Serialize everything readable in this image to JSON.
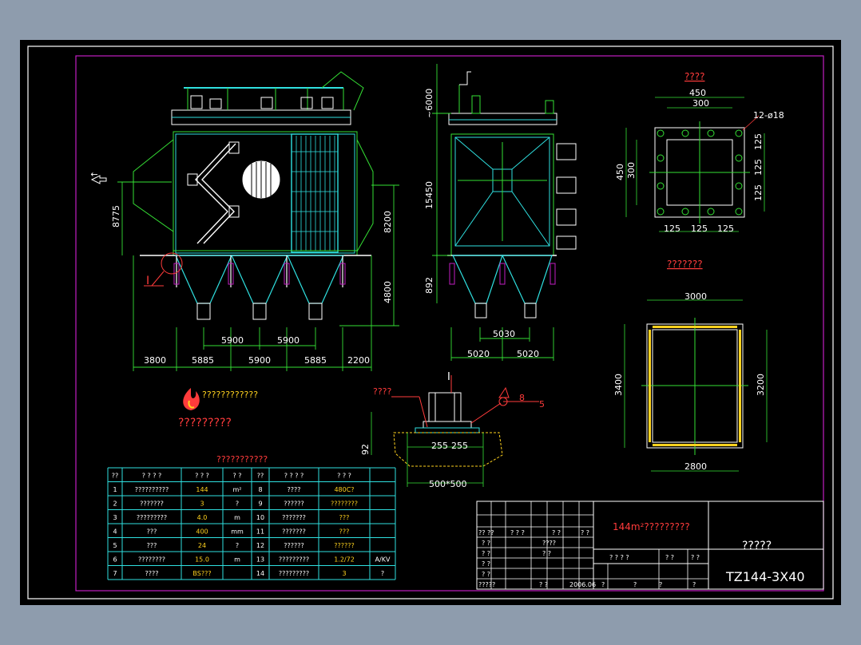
{
  "colors": {
    "background": "#8e9cad",
    "sheet": "#000000",
    "frame": "#ffffff",
    "border": "#c21ec2",
    "green": "#35e035",
    "cyan": "#2fe0e0",
    "white": "#ffffff",
    "red": "#ff3b3b",
    "yellow": "#ffd21e"
  },
  "elevation_view": {
    "flow_arrow_label": "↑",
    "dims_vertical": [
      "8775",
      "8200",
      "4800"
    ],
    "dims_top": [
      "5900",
      "5900"
    ],
    "dims_bottom": [
      "3800",
      "5885",
      "5900",
      "5885",
      "2200"
    ],
    "detail_marker": "I"
  },
  "side_view": {
    "dims_vertical": [
      "~6000",
      "15450",
      "892"
    ],
    "dims_top": [
      "5030"
    ],
    "dims_bottom": [
      "5020",
      "5020"
    ]
  },
  "flange_view": {
    "title": "????",
    "dims": [
      "450",
      "300",
      "12-ø18",
      "450",
      "300",
      "125",
      "125",
      "125",
      "125",
      "125",
      "125"
    ]
  },
  "outlet_view": {
    "title": "???????",
    "dims": [
      "3000",
      "3400",
      "3200",
      "2800"
    ]
  },
  "support_detail": {
    "marker": "I",
    "leader_label": "????",
    "weld_labels": [
      "8",
      "5"
    ],
    "dims": [
      "92",
      "255",
      "255",
      "500*500"
    ]
  },
  "logo": {
    "title_text": "????????????",
    "sub_text": "?????????"
  },
  "param_table": {
    "title": "???????????",
    "headers": [
      "??",
      "? ? ? ?",
      "? ? ?",
      "? ?",
      "??",
      "? ? ? ?",
      "? ? ?"
    ],
    "rows": [
      [
        "1",
        "??????????",
        "144",
        "m²",
        "8",
        "????",
        "480C?",
        ""
      ],
      [
        "2",
        "???????",
        "3",
        "?",
        "9",
        "??????",
        "????????",
        ""
      ],
      [
        "3",
        "?????????",
        "4.0",
        "m",
        "10",
        "???????",
        "???",
        ""
      ],
      [
        "4",
        "???",
        "400",
        "mm",
        "11",
        "???????",
        "???",
        ""
      ],
      [
        "5",
        "???",
        "24",
        "?",
        "12",
        "??????",
        "??????",
        ""
      ],
      [
        "6",
        "????????",
        "15.0",
        "m",
        "13",
        "?????????",
        "1.2/72",
        "A/KV"
      ],
      [
        "7",
        "????",
        "BS???",
        "",
        "14",
        "?????????",
        "3",
        "?"
      ]
    ]
  },
  "title_block": {
    "drawing_title": "144m²?????????",
    "name_cell": "?????",
    "code": "TZ144-3X40",
    "row_labels": [
      "?? ??",
      "? ?",
      "? ?",
      "? ?",
      "? ?",
      "?????"
    ],
    "header_cells": [
      "? ? ?",
      "? ?",
      "? ?"
    ],
    "names": [
      "????",
      "? ?"
    ],
    "right_headers": [
      "? ? ? ?",
      "? ?",
      "? ?"
    ],
    "bottom_cells": [
      "? ?",
      "2006.06",
      "?",
      "?",
      "?",
      "?"
    ]
  }
}
